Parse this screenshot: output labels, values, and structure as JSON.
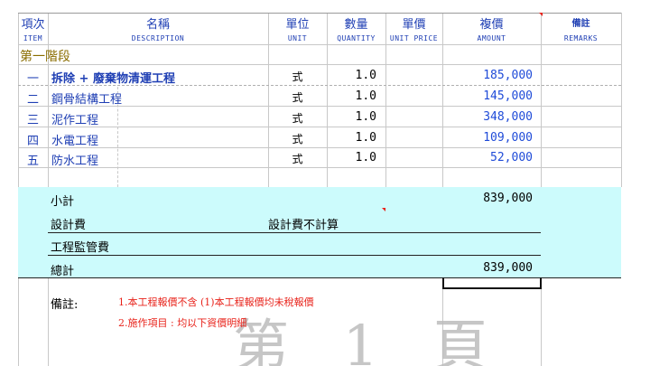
{
  "header": {
    "col_item": "項次",
    "col_name": "名稱",
    "col_unit": "單位",
    "col_qty": "數量",
    "col_price": "單價",
    "col_amount": "複價",
    "col_remarks": "備註",
    "sub_item": "ITEM",
    "sub_name": "DESCRIPTION",
    "sub_unit": "UNIT",
    "sub_qty": "QUANTITY",
    "sub_price": "UNIT PRICE",
    "sub_amount": "AMOUNT",
    "sub_remarks": "REMARKS"
  },
  "section_title": "第一階段",
  "rows": [
    {
      "item": "一",
      "name": "拆除 + 廢棄物清運工程",
      "unit": "式",
      "qty": "1.0",
      "amount": "185,000"
    },
    {
      "item": "二",
      "name": "鋼骨結構工程",
      "unit": "式",
      "qty": "1.0",
      "amount": "145,000"
    },
    {
      "item": "三",
      "name": "泥作工程",
      "unit": "式",
      "qty": "1.0",
      "amount": "348,000"
    },
    {
      "item": "四",
      "name": "水電工程",
      "unit": "式",
      "qty": "1.0",
      "amount": "109,000"
    },
    {
      "item": "五",
      "name": "防水工程",
      "unit": "式",
      "qty": "1.0",
      "amount": "52,000"
    }
  ],
  "summary": {
    "subtotal_label": "小計",
    "subtotal_value": "839,000",
    "design_fee_label": "設計費",
    "design_fee_note": "設計費不計算",
    "supervision_label": "工程監管費",
    "total_label": "總計",
    "total_value": "839,000"
  },
  "notes": {
    "label": "備註:",
    "line1": "1.本工程報價不含 (1)本工程報價均未稅報價",
    "line2": "2.施作項目 : 均以下資價明細"
  },
  "watermark": "第 1 頁",
  "colors": {
    "header_blue": "#1f3fb4",
    "amount_blue": "#1f4bd8",
    "summary_bg": "#ccfbfc",
    "note_red": "#e8221a"
  }
}
